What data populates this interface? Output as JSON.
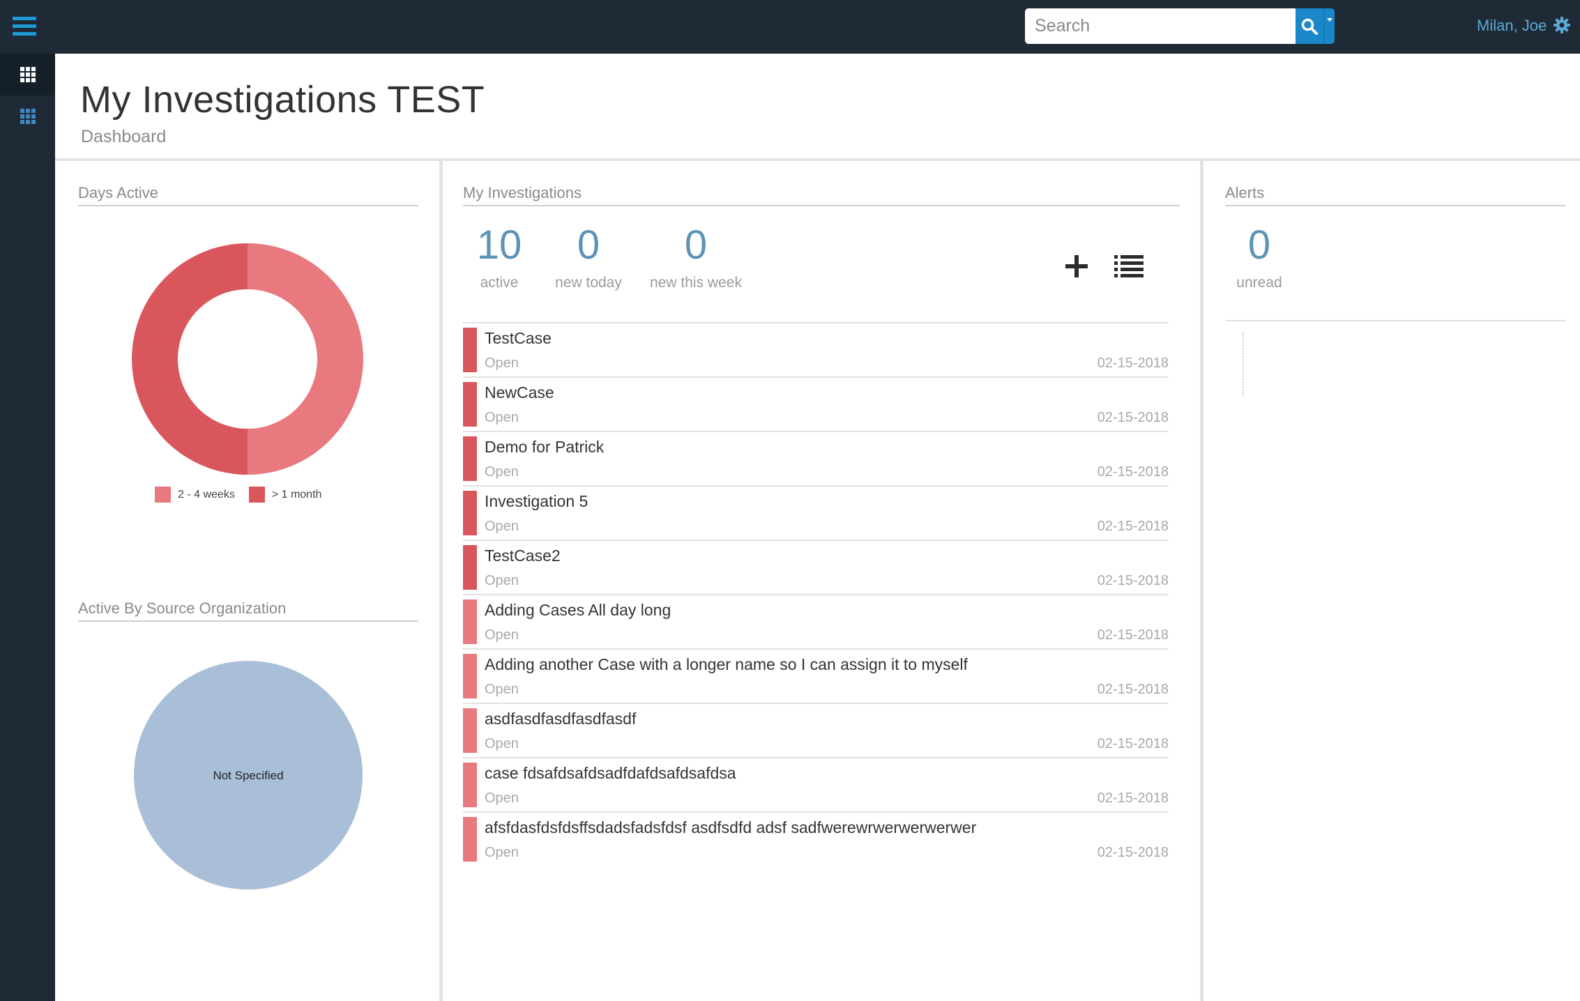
{
  "topbar": {
    "search_placeholder": "Search",
    "user_name": "Milan, Joe"
  },
  "header": {
    "title": "My Investigations TEST",
    "subtitle": "Dashboard"
  },
  "panels": {
    "days_active": "Days Active",
    "by_source": "Active By Source Organization",
    "my_investigations": "My Investigations",
    "alerts": "Alerts"
  },
  "stats": {
    "active": {
      "value": "10",
      "label": "active"
    },
    "new_today": {
      "value": "0",
      "label": "new today"
    },
    "new_week": {
      "value": "0",
      "label": "new this week"
    },
    "unread": {
      "value": "0",
      "label": "unread"
    }
  },
  "colors": {
    "bar_dark": "#d9575c",
    "bar_light": "#e8797f",
    "accent": "#1a87c9"
  },
  "investigations": [
    {
      "name": "TestCase",
      "status": "Open",
      "date": "02-15-2018",
      "tone": "dark"
    },
    {
      "name": "NewCase",
      "status": "Open",
      "date": "02-15-2018",
      "tone": "dark"
    },
    {
      "name": "Demo for Patrick",
      "status": "Open",
      "date": "02-15-2018",
      "tone": "dark"
    },
    {
      "name": "Investigation 5",
      "status": "Open",
      "date": "02-15-2018",
      "tone": "dark"
    },
    {
      "name": "TestCase2",
      "status": "Open",
      "date": "02-15-2018",
      "tone": "dark"
    },
    {
      "name": "Adding Cases All day long",
      "status": "Open",
      "date": "02-15-2018",
      "tone": "light"
    },
    {
      "name": "Adding another Case with a longer name so I can assign it to myself",
      "status": "Open",
      "date": "02-15-2018",
      "tone": "light"
    },
    {
      "name": "asdfasdfasdfasdfasdf",
      "status": "Open",
      "date": "02-15-2018",
      "tone": "light"
    },
    {
      "name": "case fdsafdsafdsadfdafdsafdsafdsa",
      "status": "Open",
      "date": "02-15-2018",
      "tone": "light"
    },
    {
      "name": "afsfdasfdsfdsffsdadsfadsfdsf asdfsdfd adsf sadfwerewrwerwerwerwer",
      "status": "Open",
      "date": "02-15-2018",
      "tone": "light"
    }
  ],
  "chart_data": [
    {
      "type": "pie",
      "variant": "donut",
      "categories": [
        "2 - 4 weeks",
        "> 1 month"
      ],
      "values": [
        5,
        5
      ],
      "colors": [
        "#e8797f",
        "#d9575c"
      ],
      "legend": "bottom"
    },
    {
      "type": "pie",
      "categories": [
        "Not Specified"
      ],
      "values": [
        10
      ],
      "colors": [
        "#a9bfd8"
      ]
    }
  ]
}
